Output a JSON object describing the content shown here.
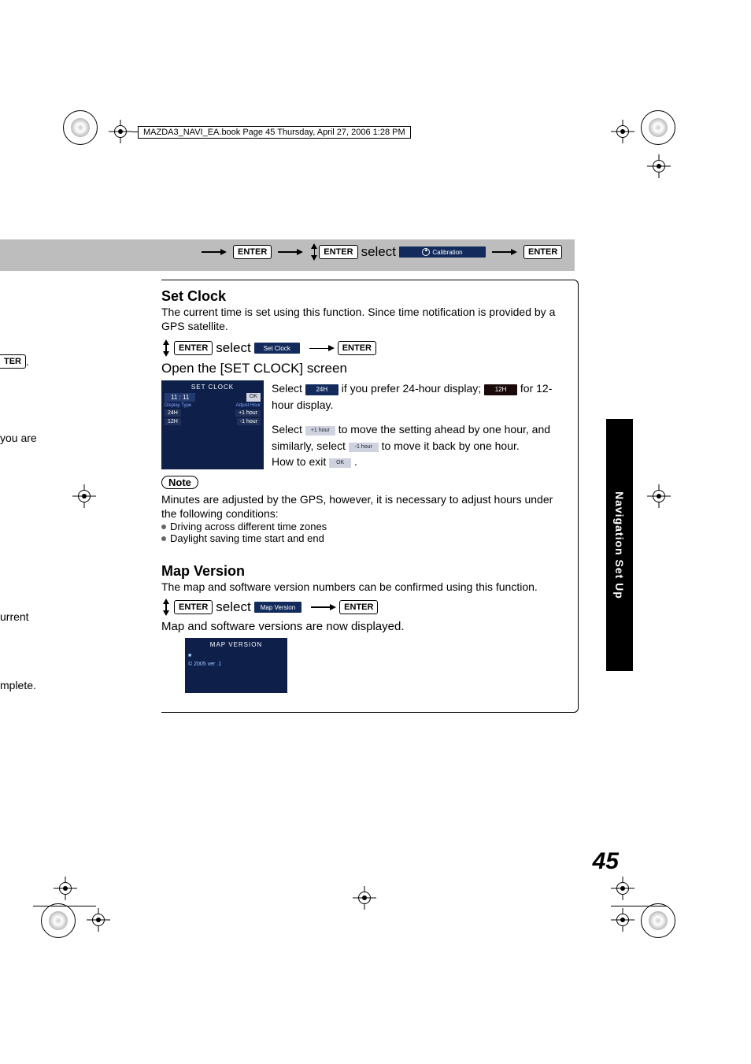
{
  "header": {
    "text": "MAZDA3_NAVI_EA.book  Page 45  Thursday, April 27, 2006  1:28 PM"
  },
  "keys": {
    "enter": "ENTER",
    "ter": "TER"
  },
  "band": {
    "select": "select",
    "calibration": "Calibration"
  },
  "setClock": {
    "title": "Set Clock",
    "intro": "The current time is set using this function. Since time notification is provided by a GPS satellite.",
    "select": "select",
    "btnSetClock": "Set Clock",
    "openScreen": "Open the [SET CLOCK] screen",
    "screenshot": {
      "title": "SET CLOCK",
      "time": "11 : 11",
      "ok": "OK",
      "displayType": "Display Type",
      "adjustHour": "Adjust Hour",
      "b24": "24H",
      "p1": "+1 hour",
      "b12": "12H",
      "m1": "-1 hour"
    },
    "p1a": "Select ",
    "p1b": " if you prefer 24-hour display; ",
    "p1c": " for 12-hour display.",
    "p2a": "Select ",
    "p2b": " to move the setting ahead by one hour, and similarly, select ",
    "p2c": " to move it back by one hour.",
    "howExit": "How to exit ",
    "btn24H": "24H",
    "btn12H": "12H",
    "btnPlus1": "+1 hour",
    "btnMinus1": "-1 hour",
    "btnOK": "OK"
  },
  "note": {
    "label": "Note",
    "text1": "Minutes are adjusted by the GPS, however, it is necessary to adjust hours under the following conditions:",
    "b1": "Driving across different time zones",
    "b2": "Daylight saving time start and end"
  },
  "mapVersion": {
    "title": "Map Version",
    "intro": "The map and software version numbers can be confirmed using this function.",
    "select": "select",
    "btnMapVersion": "Map Version",
    "displayed": "Map and software versions are now displayed.",
    "screenshot": {
      "title": "MAP VERSION",
      "line": "© 2005 ver .1"
    }
  },
  "sideTab": "Navigation Set Up",
  "pageNum": "45",
  "cutoff": {
    "youAre": "you are",
    "urrent": "urrent",
    "mplete": "mplete.",
    "dot": " ."
  }
}
